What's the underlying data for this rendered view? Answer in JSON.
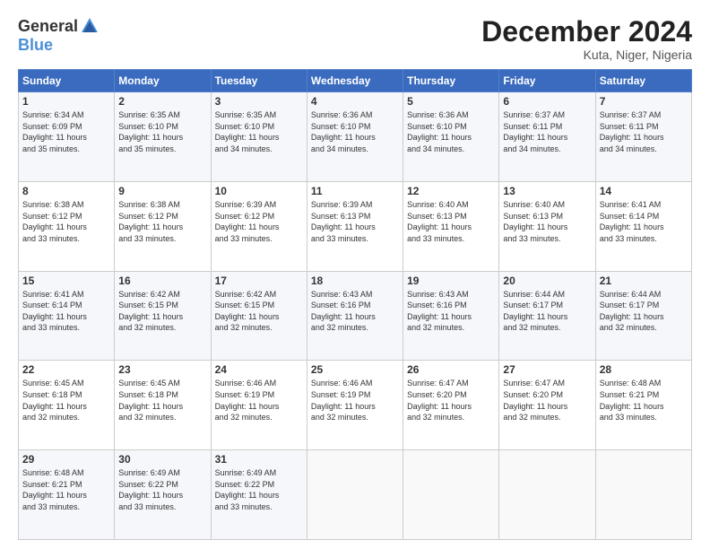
{
  "header": {
    "logo_general": "General",
    "logo_blue": "Blue",
    "month_title": "December 2024",
    "subtitle": "Kuta, Niger, Nigeria"
  },
  "days_of_week": [
    "Sunday",
    "Monday",
    "Tuesday",
    "Wednesday",
    "Thursday",
    "Friday",
    "Saturday"
  ],
  "weeks": [
    [
      {
        "day": "1",
        "info": "Sunrise: 6:34 AM\nSunset: 6:09 PM\nDaylight: 11 hours\nand 35 minutes."
      },
      {
        "day": "2",
        "info": "Sunrise: 6:35 AM\nSunset: 6:10 PM\nDaylight: 11 hours\nand 35 minutes."
      },
      {
        "day": "3",
        "info": "Sunrise: 6:35 AM\nSunset: 6:10 PM\nDaylight: 11 hours\nand 34 minutes."
      },
      {
        "day": "4",
        "info": "Sunrise: 6:36 AM\nSunset: 6:10 PM\nDaylight: 11 hours\nand 34 minutes."
      },
      {
        "day": "5",
        "info": "Sunrise: 6:36 AM\nSunset: 6:10 PM\nDaylight: 11 hours\nand 34 minutes."
      },
      {
        "day": "6",
        "info": "Sunrise: 6:37 AM\nSunset: 6:11 PM\nDaylight: 11 hours\nand 34 minutes."
      },
      {
        "day": "7",
        "info": "Sunrise: 6:37 AM\nSunset: 6:11 PM\nDaylight: 11 hours\nand 34 minutes."
      }
    ],
    [
      {
        "day": "8",
        "info": "Sunrise: 6:38 AM\nSunset: 6:12 PM\nDaylight: 11 hours\nand 33 minutes."
      },
      {
        "day": "9",
        "info": "Sunrise: 6:38 AM\nSunset: 6:12 PM\nDaylight: 11 hours\nand 33 minutes."
      },
      {
        "day": "10",
        "info": "Sunrise: 6:39 AM\nSunset: 6:12 PM\nDaylight: 11 hours\nand 33 minutes."
      },
      {
        "day": "11",
        "info": "Sunrise: 6:39 AM\nSunset: 6:13 PM\nDaylight: 11 hours\nand 33 minutes."
      },
      {
        "day": "12",
        "info": "Sunrise: 6:40 AM\nSunset: 6:13 PM\nDaylight: 11 hours\nand 33 minutes."
      },
      {
        "day": "13",
        "info": "Sunrise: 6:40 AM\nSunset: 6:13 PM\nDaylight: 11 hours\nand 33 minutes."
      },
      {
        "day": "14",
        "info": "Sunrise: 6:41 AM\nSunset: 6:14 PM\nDaylight: 11 hours\nand 33 minutes."
      }
    ],
    [
      {
        "day": "15",
        "info": "Sunrise: 6:41 AM\nSunset: 6:14 PM\nDaylight: 11 hours\nand 33 minutes."
      },
      {
        "day": "16",
        "info": "Sunrise: 6:42 AM\nSunset: 6:15 PM\nDaylight: 11 hours\nand 32 minutes."
      },
      {
        "day": "17",
        "info": "Sunrise: 6:42 AM\nSunset: 6:15 PM\nDaylight: 11 hours\nand 32 minutes."
      },
      {
        "day": "18",
        "info": "Sunrise: 6:43 AM\nSunset: 6:16 PM\nDaylight: 11 hours\nand 32 minutes."
      },
      {
        "day": "19",
        "info": "Sunrise: 6:43 AM\nSunset: 6:16 PM\nDaylight: 11 hours\nand 32 minutes."
      },
      {
        "day": "20",
        "info": "Sunrise: 6:44 AM\nSunset: 6:17 PM\nDaylight: 11 hours\nand 32 minutes."
      },
      {
        "day": "21",
        "info": "Sunrise: 6:44 AM\nSunset: 6:17 PM\nDaylight: 11 hours\nand 32 minutes."
      }
    ],
    [
      {
        "day": "22",
        "info": "Sunrise: 6:45 AM\nSunset: 6:18 PM\nDaylight: 11 hours\nand 32 minutes."
      },
      {
        "day": "23",
        "info": "Sunrise: 6:45 AM\nSunset: 6:18 PM\nDaylight: 11 hours\nand 32 minutes."
      },
      {
        "day": "24",
        "info": "Sunrise: 6:46 AM\nSunset: 6:19 PM\nDaylight: 11 hours\nand 32 minutes."
      },
      {
        "day": "25",
        "info": "Sunrise: 6:46 AM\nSunset: 6:19 PM\nDaylight: 11 hours\nand 32 minutes."
      },
      {
        "day": "26",
        "info": "Sunrise: 6:47 AM\nSunset: 6:20 PM\nDaylight: 11 hours\nand 32 minutes."
      },
      {
        "day": "27",
        "info": "Sunrise: 6:47 AM\nSunset: 6:20 PM\nDaylight: 11 hours\nand 32 minutes."
      },
      {
        "day": "28",
        "info": "Sunrise: 6:48 AM\nSunset: 6:21 PM\nDaylight: 11 hours\nand 33 minutes."
      }
    ],
    [
      {
        "day": "29",
        "info": "Sunrise: 6:48 AM\nSunset: 6:21 PM\nDaylight: 11 hours\nand 33 minutes."
      },
      {
        "day": "30",
        "info": "Sunrise: 6:49 AM\nSunset: 6:22 PM\nDaylight: 11 hours\nand 33 minutes."
      },
      {
        "day": "31",
        "info": "Sunrise: 6:49 AM\nSunset: 6:22 PM\nDaylight: 11 hours\nand 33 minutes."
      },
      {
        "day": "",
        "info": ""
      },
      {
        "day": "",
        "info": ""
      },
      {
        "day": "",
        "info": ""
      },
      {
        "day": "",
        "info": ""
      }
    ]
  ]
}
